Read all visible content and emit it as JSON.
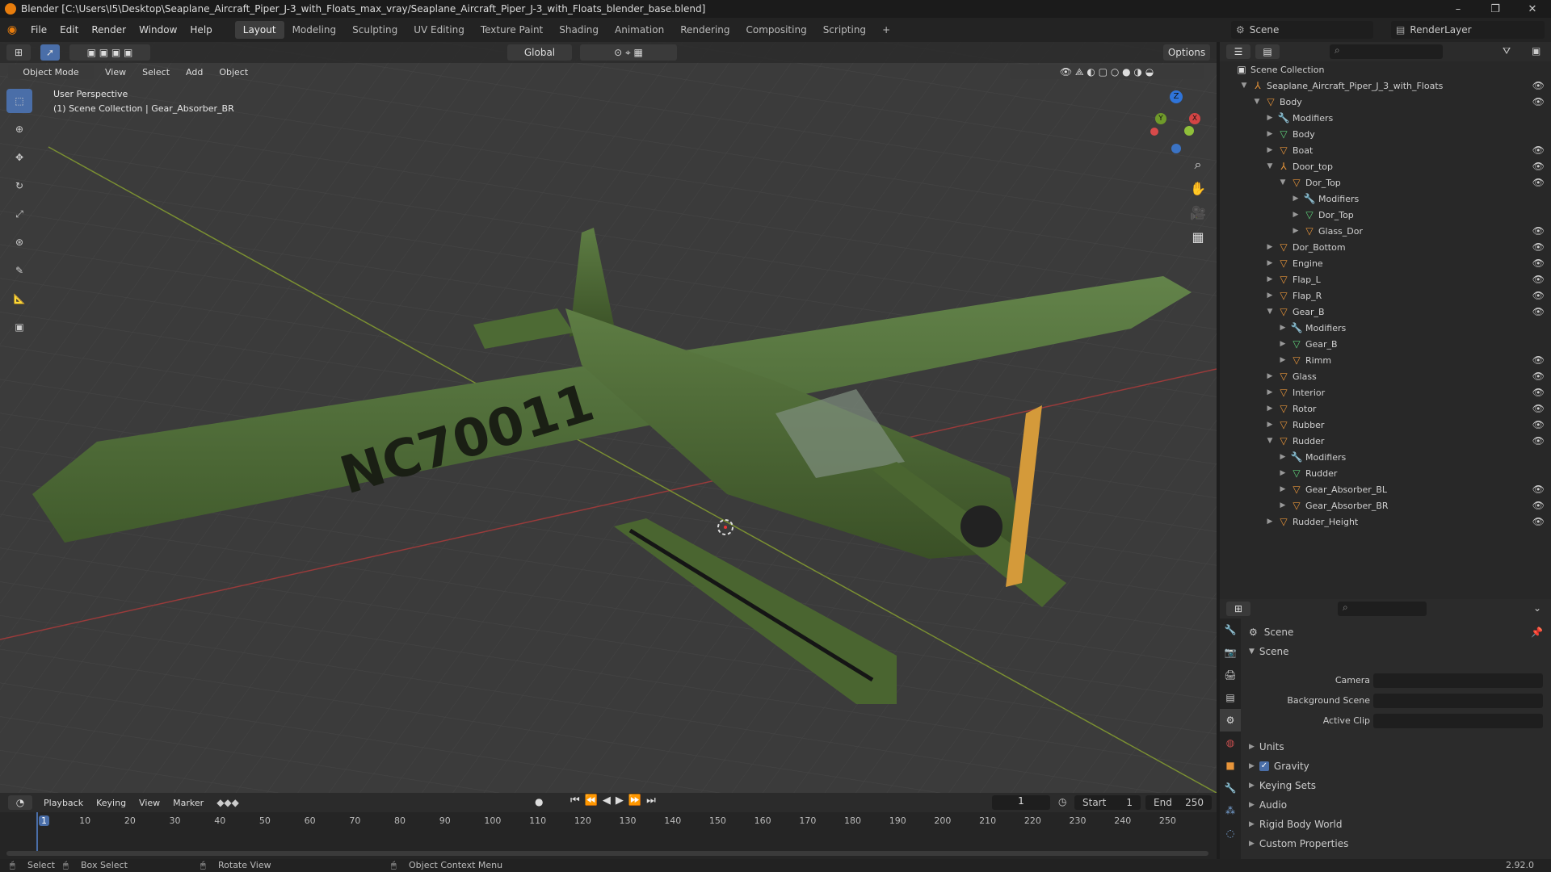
{
  "window": {
    "title": "Blender [C:\\Users\\I5\\Desktop\\Seaplane_Aircraft_Piper_J-3_with_Floats_max_vray/Seaplane_Aircraft_Piper_J-3_with_Floats_blender_base.blend]",
    "minimize": "–",
    "maximize": "❐",
    "close": "✕"
  },
  "menu": [
    "File",
    "Edit",
    "Render",
    "Window",
    "Help"
  ],
  "workspaces": [
    "Layout",
    "Modeling",
    "Sculpting",
    "UV Editing",
    "Texture Paint",
    "Shading",
    "Animation",
    "Rendering",
    "Compositing",
    "Scripting"
  ],
  "workspace_add": "+",
  "top_right": {
    "scene": "Scene",
    "render_layer": "RenderLayer"
  },
  "viewport_header": {
    "transform_orientation": "Global",
    "options": "Options",
    "mode": "Object Mode",
    "menus": [
      "View",
      "Select",
      "Add",
      "Object"
    ]
  },
  "viewport_overlay": {
    "perspective": "User Perspective",
    "collection_info": "(1) Scene Collection | Gear_Absorber_BR"
  },
  "gizmo_axes": {
    "z": "Z",
    "y": "Y",
    "x": "X"
  },
  "aircraft_registration": "NC70011",
  "outliner": {
    "root": "Scene Collection",
    "items": [
      {
        "label": "Seaplane_Aircraft_Piper_J_3_with_Floats",
        "depth": 1,
        "icon": "armature",
        "expanded": true,
        "eye": true
      },
      {
        "label": "Body",
        "depth": 2,
        "icon": "object",
        "expanded": true,
        "eye": true
      },
      {
        "label": "Modifiers",
        "depth": 3,
        "icon": "modifier",
        "expanded": false,
        "eye": false
      },
      {
        "label": "Body",
        "depth": 3,
        "icon": "mesh",
        "expanded": false,
        "eye": false
      },
      {
        "label": "Boat",
        "depth": 3,
        "icon": "object",
        "expanded": false,
        "eye": true
      },
      {
        "label": "Door_top",
        "depth": 3,
        "icon": "armature",
        "expanded": true,
        "eye": true
      },
      {
        "label": "Dor_Top",
        "depth": 4,
        "icon": "object",
        "expanded": true,
        "eye": true
      },
      {
        "label": "Modifiers",
        "depth": 5,
        "icon": "modifier",
        "expanded": false,
        "eye": false
      },
      {
        "label": "Dor_Top",
        "depth": 5,
        "icon": "mesh",
        "expanded": false,
        "eye": false
      },
      {
        "label": "Glass_Dor",
        "depth": 5,
        "icon": "object",
        "expanded": false,
        "eye": true
      },
      {
        "label": "Dor_Bottom",
        "depth": 3,
        "icon": "object",
        "expanded": false,
        "eye": true
      },
      {
        "label": "Engine",
        "depth": 3,
        "icon": "object",
        "expanded": false,
        "eye": true
      },
      {
        "label": "Flap_L",
        "depth": 3,
        "icon": "object",
        "expanded": false,
        "eye": true
      },
      {
        "label": "Flap_R",
        "depth": 3,
        "icon": "object",
        "expanded": false,
        "eye": true
      },
      {
        "label": "Gear_B",
        "depth": 3,
        "icon": "object",
        "expanded": true,
        "eye": true
      },
      {
        "label": "Modifiers",
        "depth": 4,
        "icon": "modifier",
        "expanded": false,
        "eye": false
      },
      {
        "label": "Gear_B",
        "depth": 4,
        "icon": "mesh",
        "expanded": false,
        "eye": false
      },
      {
        "label": "Rimm",
        "depth": 4,
        "icon": "object",
        "expanded": false,
        "eye": true
      },
      {
        "label": "Glass",
        "depth": 3,
        "icon": "object",
        "expanded": false,
        "eye": true
      },
      {
        "label": "Interior",
        "depth": 3,
        "icon": "object",
        "expanded": false,
        "eye": true
      },
      {
        "label": "Rotor",
        "depth": 3,
        "icon": "object",
        "expanded": false,
        "eye": true
      },
      {
        "label": "Rubber",
        "depth": 3,
        "icon": "object",
        "expanded": false,
        "eye": true
      },
      {
        "label": "Rudder",
        "depth": 3,
        "icon": "object",
        "expanded": true,
        "eye": true
      },
      {
        "label": "Modifiers",
        "depth": 4,
        "icon": "modifier",
        "expanded": false,
        "eye": false
      },
      {
        "label": "Rudder",
        "depth": 4,
        "icon": "mesh",
        "expanded": false,
        "eye": false
      },
      {
        "label": "Gear_Absorber_BL",
        "depth": 4,
        "icon": "object",
        "expanded": false,
        "eye": true
      },
      {
        "label": "Gear_Absorber_BR",
        "depth": 4,
        "icon": "object",
        "expanded": false,
        "eye": true
      },
      {
        "label": "Rudder_Height",
        "depth": 3,
        "icon": "object",
        "expanded": false,
        "eye": true
      }
    ]
  },
  "properties": {
    "context": "Scene",
    "panel": "Scene",
    "fields": [
      {
        "label": "Camera",
        "value": ""
      },
      {
        "label": "Background Scene",
        "value": ""
      },
      {
        "label": "Active Clip",
        "value": ""
      }
    ],
    "sections": [
      {
        "label": "Units",
        "checkbox": false
      },
      {
        "label": "Gravity",
        "checkbox": true
      },
      {
        "label": "Keying Sets",
        "checkbox": false
      },
      {
        "label": "Audio",
        "checkbox": false
      },
      {
        "label": "Rigid Body World",
        "checkbox": false
      },
      {
        "label": "Custom Properties",
        "checkbox": false
      }
    ]
  },
  "timeline": {
    "menus": [
      "Playback",
      "Keying",
      "View",
      "Marker"
    ],
    "current_frame": "1",
    "start_label": "Start",
    "start": "1",
    "end_label": "End",
    "end": "250",
    "ticks": [
      "1",
      "10",
      "20",
      "30",
      "40",
      "50",
      "60",
      "70",
      "80",
      "90",
      "100",
      "110",
      "120",
      "130",
      "140",
      "150",
      "160",
      "170",
      "180",
      "190",
      "200",
      "210",
      "220",
      "230",
      "240",
      "250"
    ]
  },
  "statusbar": {
    "select": "Select",
    "box_select": "Box Select",
    "rotate": "Rotate View",
    "context_menu": "Object Context Menu",
    "version": "2.92.0"
  },
  "colors": {
    "accent": "#4a6ea8",
    "object": "#e8953a",
    "mesh": "#5fd07b",
    "modifier": "#7aa6d9",
    "material": "#e06060",
    "plane": "#4e6a35"
  }
}
